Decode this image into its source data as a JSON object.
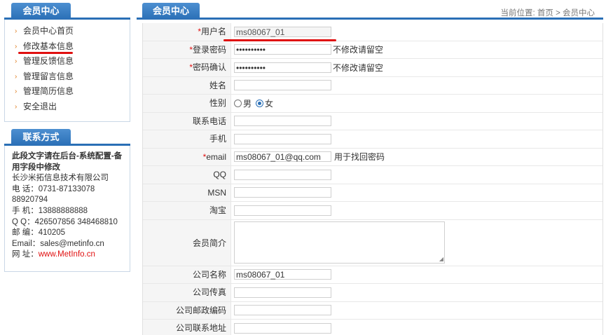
{
  "sidebar": {
    "title": "会员中心",
    "items": [
      {
        "label": "会员中心首页"
      },
      {
        "label": "修改基本信息"
      },
      {
        "label": "管理反馈信息"
      },
      {
        "label": "管理留言信息"
      },
      {
        "label": "管理简历信息"
      },
      {
        "label": "安全退出"
      }
    ]
  },
  "contact": {
    "title": "联系方式",
    "note": "此段文字请在后台-系统配置-备用字段中修改",
    "company": "长沙米拓信息技术有限公司",
    "phone": "电  话：0731-87133078",
    "phone2": "88920794",
    "mobile": "手  机：13888888888",
    "qq": "Q    Q：426507856 348468810",
    "zip": "邮  编：410205",
    "email": "Email：sales@metinfo.cn",
    "web_label": "网  址：",
    "web_link": "www.MetInfo.cn"
  },
  "main": {
    "title": "会员中心",
    "breadcrumb": "当前位置: 首页 > 会员中心"
  },
  "form": {
    "username_label": "用户名",
    "username_value": "ms08067_01",
    "password_label": "登录密码",
    "password_value": "••••••••••",
    "password_hint": "不修改请留空",
    "confirm_label": "密码确认",
    "confirm_value": "••••••••••",
    "confirm_hint": "不修改请留空",
    "name_label": "姓名",
    "gender_label": "性别",
    "gender_male": "男",
    "gender_female": "女",
    "gender_selected": "女",
    "tel_label": "联系电话",
    "mobile_label": "手机",
    "email_label": "email",
    "email_value": "ms08067_01@qq.com",
    "email_hint": "用于找回密码",
    "qq_label": "QQ",
    "msn_label": "MSN",
    "taobao_label": "淘宝",
    "intro_label": "会员简介",
    "company_label": "公司名称",
    "company_value": "ms08067_01",
    "fax_label": "公司传真",
    "zip_label": "公司邮政编码",
    "address_label": "公司联系地址"
  },
  "colors": {
    "accent": "#2a6fb6",
    "required": "#e01010",
    "arrow": "#e07b1b"
  }
}
